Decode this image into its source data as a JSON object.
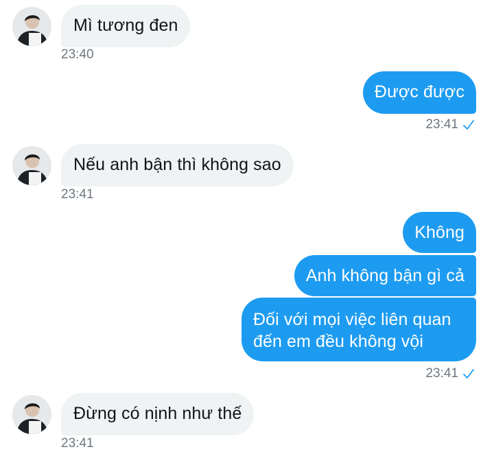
{
  "conversation": {
    "messages": [
      {
        "direction": "in",
        "text": "Mì tương đen"
      },
      {
        "direction": "out",
        "text": "Được được"
      },
      {
        "direction": "in",
        "text": "Nếu anh bận thì không sao"
      },
      {
        "direction": "out",
        "text": "Không"
      },
      {
        "direction": "out",
        "text": "Anh không bận gì cả"
      },
      {
        "direction": "out",
        "text": "Đối với mọi việc liên quan đến em đều không vội"
      },
      {
        "direction": "in",
        "text": "Đừng có nịnh như thế"
      }
    ],
    "timestamps": [
      "23:40",
      "23:41",
      "23:41",
      "23:41",
      "23:41"
    ]
  },
  "colors": {
    "incoming_bubble": "#eff3f4",
    "outgoing_bubble": "#1d9bf0",
    "timestamp": "#6e767d",
    "read_check": "#1d9bf0"
  },
  "icons": {
    "read_receipt": "check-icon",
    "avatar": "avatar"
  }
}
